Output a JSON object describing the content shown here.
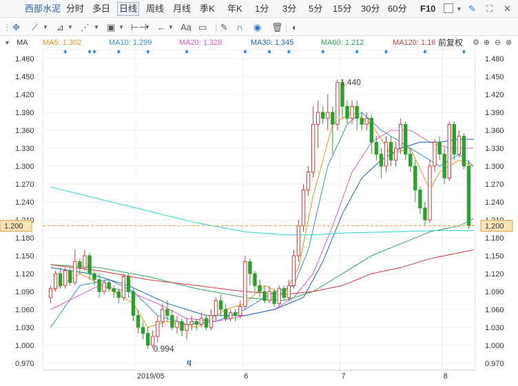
{
  "toolbar": {
    "symbol": "西部水泥",
    "periods": [
      "分时",
      "多日",
      "日线",
      "周线",
      "月线",
      "季K",
      "年K",
      "1分",
      "3分",
      "5分",
      "15分",
      "30分",
      "60分"
    ],
    "active_period": "日线",
    "f10": "F10"
  },
  "drawing_toolbar": {
    "aa_label": "Aa"
  },
  "ma_bar": {
    "title": "MA",
    "items": [
      {
        "label": "MA5: 1.302",
        "color": "#f0901a"
      },
      {
        "label": "MA10: 1.299",
        "color": "#2f8fe0"
      },
      {
        "label": "MA20: 1.328",
        "color": "#d85cd2"
      },
      {
        "label": "MA30: 1.345",
        "color": "#1565c0"
      },
      {
        "label": "MA60: 1.212",
        "color": "#2fa65a"
      },
      {
        "label": "MA120: 1.16",
        "color": "#d23b3b"
      }
    ],
    "adjust_label": "前复权"
  },
  "chart_data": {
    "type": "candlestick",
    "y_ticks": [
      "1.480",
      "1.450",
      "1.420",
      "1.390",
      "1.360",
      "1.330",
      "1.300",
      "1.270",
      "1.240",
      "1.210",
      "1.180",
      "1.150",
      "1.120",
      "1.090",
      "1.060",
      "1.030",
      "1.000",
      "0.970"
    ],
    "ylim": [
      0.97,
      1.48
    ],
    "x_labels": [
      "2019/05",
      "6",
      "7",
      "8"
    ],
    "current_price": "1.200",
    "max_label": "1.440",
    "min_label": "0.994",
    "marker_label": "q",
    "up_color": "#d23b3b",
    "down_color": "#2ca02c",
    "candles": [
      [
        1.08,
        1.095,
        1.07,
        1.1
      ],
      [
        1.095,
        1.12,
        1.09,
        1.125
      ],
      [
        1.12,
        1.1,
        1.095,
        1.13
      ],
      [
        1.1,
        1.125,
        1.095,
        1.13
      ],
      [
        1.125,
        1.105,
        1.1,
        1.13
      ],
      [
        1.105,
        1.14,
        1.1,
        1.16
      ],
      [
        1.14,
        1.13,
        1.12,
        1.145
      ],
      [
        1.13,
        1.15,
        1.125,
        1.16
      ],
      [
        1.15,
        1.12,
        1.11,
        1.155
      ],
      [
        1.12,
        1.11,
        1.1,
        1.125
      ],
      [
        1.11,
        1.09,
        1.08,
        1.12
      ],
      [
        1.09,
        1.105,
        1.085,
        1.11
      ],
      [
        1.105,
        1.095,
        1.09,
        1.11
      ],
      [
        1.095,
        1.09,
        1.08,
        1.1
      ],
      [
        1.09,
        1.08,
        1.07,
        1.095
      ],
      [
        1.08,
        1.115,
        1.075,
        1.12
      ],
      [
        1.115,
        1.09,
        1.08,
        1.12
      ],
      [
        1.09,
        1.05,
        1.04,
        1.095
      ],
      [
        1.05,
        1.03,
        1.02,
        1.06
      ],
      [
        1.03,
        1.02,
        1.01,
        1.04
      ],
      [
        1.02,
        1.0,
        0.994,
        1.03
      ],
      [
        1.0,
        1.015,
        0.995,
        1.025
      ],
      [
        1.015,
        1.04,
        1.005,
        1.05
      ],
      [
        1.04,
        1.06,
        1.03,
        1.07
      ],
      [
        1.06,
        1.05,
        1.04,
        1.075
      ],
      [
        1.05,
        1.03,
        1.025,
        1.06
      ],
      [
        1.03,
        1.04,
        1.02,
        1.05
      ],
      [
        1.04,
        1.025,
        1.015,
        1.045
      ],
      [
        1.025,
        1.035,
        1.01,
        1.045
      ],
      [
        1.035,
        1.04,
        1.025,
        1.05
      ],
      [
        1.04,
        1.035,
        1.025,
        1.045
      ],
      [
        1.035,
        1.045,
        1.03,
        1.055
      ],
      [
        1.045,
        1.03,
        1.025,
        1.05
      ],
      [
        1.03,
        1.05,
        1.025,
        1.06
      ],
      [
        1.05,
        1.075,
        1.04,
        1.08
      ],
      [
        1.075,
        1.06,
        1.05,
        1.085
      ],
      [
        1.06,
        1.045,
        1.04,
        1.07
      ],
      [
        1.045,
        1.055,
        1.04,
        1.06
      ],
      [
        1.055,
        1.05,
        1.04,
        1.06
      ],
      [
        1.05,
        1.065,
        1.045,
        1.075
      ],
      [
        1.065,
        1.14,
        1.06,
        1.15
      ],
      [
        1.14,
        1.12,
        1.1,
        1.145
      ],
      [
        1.12,
        1.1,
        1.09,
        1.125
      ],
      [
        1.1,
        1.09,
        1.08,
        1.11
      ],
      [
        1.09,
        1.075,
        1.07,
        1.1
      ],
      [
        1.075,
        1.09,
        1.07,
        1.1
      ],
      [
        1.09,
        1.07,
        1.065,
        1.095
      ],
      [
        1.07,
        1.095,
        1.065,
        1.1
      ],
      [
        1.095,
        1.08,
        1.075,
        1.1
      ],
      [
        1.08,
        1.1,
        1.075,
        1.11
      ],
      [
        1.1,
        1.15,
        1.095,
        1.16
      ],
      [
        1.15,
        1.2,
        1.14,
        1.21
      ],
      [
        1.2,
        1.26,
        1.19,
        1.27
      ],
      [
        1.26,
        1.29,
        1.25,
        1.3
      ],
      [
        1.29,
        1.37,
        1.28,
        1.4
      ],
      [
        1.37,
        1.39,
        1.33,
        1.41
      ],
      [
        1.39,
        1.38,
        1.37,
        1.4
      ],
      [
        1.38,
        1.39,
        1.36,
        1.42
      ],
      [
        1.39,
        1.37,
        1.32,
        1.4
      ],
      [
        1.37,
        1.44,
        1.36,
        1.445
      ],
      [
        1.44,
        1.4,
        1.38,
        1.445
      ],
      [
        1.4,
        1.38,
        1.37,
        1.41
      ],
      [
        1.38,
        1.4,
        1.37,
        1.41
      ],
      [
        1.4,
        1.38,
        1.36,
        1.41
      ],
      [
        1.38,
        1.37,
        1.36,
        1.39
      ],
      [
        1.37,
        1.38,
        1.36,
        1.39
      ],
      [
        1.38,
        1.34,
        1.32,
        1.385
      ],
      [
        1.34,
        1.32,
        1.31,
        1.35
      ],
      [
        1.32,
        1.3,
        1.28,
        1.33
      ],
      [
        1.3,
        1.34,
        1.29,
        1.35
      ],
      [
        1.34,
        1.31,
        1.3,
        1.35
      ],
      [
        1.31,
        1.33,
        1.3,
        1.34
      ],
      [
        1.33,
        1.37,
        1.32,
        1.38
      ],
      [
        1.37,
        1.32,
        1.31,
        1.375
      ],
      [
        1.32,
        1.3,
        1.29,
        1.33
      ],
      [
        1.3,
        1.26,
        1.24,
        1.31
      ],
      [
        1.26,
        1.23,
        1.22,
        1.265
      ],
      [
        1.23,
        1.21,
        1.2,
        1.24
      ],
      [
        1.21,
        1.3,
        1.205,
        1.31
      ],
      [
        1.3,
        1.34,
        1.29,
        1.345
      ],
      [
        1.34,
        1.32,
        1.31,
        1.35
      ],
      [
        1.32,
        1.28,
        1.27,
        1.33
      ],
      [
        1.28,
        1.37,
        1.275,
        1.375
      ],
      [
        1.37,
        1.32,
        1.31,
        1.375
      ],
      [
        1.32,
        1.35,
        1.315,
        1.36
      ],
      [
        1.35,
        1.3,
        1.295,
        1.355
      ],
      [
        1.3,
        1.2,
        1.195,
        1.31
      ]
    ],
    "ma_series": [
      {
        "name": "MA5",
        "color": "#f0901a",
        "points": [
          [
            0,
            1.09
          ],
          [
            6,
            1.12
          ],
          [
            12,
            1.095
          ],
          [
            17,
            1.07
          ],
          [
            20,
            1.03
          ],
          [
            24,
            1.04
          ],
          [
            30,
            1.03
          ],
          [
            36,
            1.06
          ],
          [
            40,
            1.07
          ],
          [
            44,
            1.1
          ],
          [
            48,
            1.085
          ],
          [
            51,
            1.13
          ],
          [
            54,
            1.25
          ],
          [
            58,
            1.37
          ],
          [
            62,
            1.39
          ],
          [
            66,
            1.37
          ],
          [
            70,
            1.32
          ],
          [
            74,
            1.33
          ],
          [
            78,
            1.26
          ],
          [
            80,
            1.29
          ],
          [
            84,
            1.31
          ],
          [
            87,
            1.3
          ]
        ]
      },
      {
        "name": "MA10",
        "color": "#2f8fe0",
        "points": [
          [
            0,
            1.03
          ],
          [
            6,
            1.1
          ],
          [
            12,
            1.11
          ],
          [
            17,
            1.09
          ],
          [
            22,
            1.05
          ],
          [
            28,
            1.035
          ],
          [
            34,
            1.04
          ],
          [
            40,
            1.06
          ],
          [
            45,
            1.085
          ],
          [
            50,
            1.1
          ],
          [
            53,
            1.16
          ],
          [
            57,
            1.3
          ],
          [
            61,
            1.37
          ],
          [
            64,
            1.39
          ],
          [
            68,
            1.36
          ],
          [
            72,
            1.34
          ],
          [
            76,
            1.32
          ],
          [
            80,
            1.3
          ],
          [
            84,
            1.32
          ],
          [
            87,
            1.3
          ]
        ]
      },
      {
        "name": "MA20",
        "color": "#d85cd2",
        "points": [
          [
            0,
            1.06
          ],
          [
            5,
            1.08
          ],
          [
            10,
            1.1
          ],
          [
            16,
            1.09
          ],
          [
            22,
            1.07
          ],
          [
            28,
            1.045
          ],
          [
            34,
            1.04
          ],
          [
            40,
            1.05
          ],
          [
            46,
            1.06
          ],
          [
            50,
            1.08
          ],
          [
            54,
            1.12
          ],
          [
            58,
            1.2
          ],
          [
            62,
            1.29
          ],
          [
            66,
            1.34
          ],
          [
            70,
            1.36
          ],
          [
            74,
            1.36
          ],
          [
            78,
            1.34
          ],
          [
            82,
            1.33
          ],
          [
            87,
            1.33
          ]
        ]
      },
      {
        "name": "MA30",
        "color": "#1565c0",
        "points": [
          [
            0,
            1.13
          ],
          [
            8,
            1.12
          ],
          [
            16,
            1.1
          ],
          [
            24,
            1.07
          ],
          [
            32,
            1.05
          ],
          [
            40,
            1.05
          ],
          [
            46,
            1.06
          ],
          [
            52,
            1.08
          ],
          [
            56,
            1.14
          ],
          [
            60,
            1.22
          ],
          [
            64,
            1.28
          ],
          [
            68,
            1.31
          ],
          [
            72,
            1.33
          ],
          [
            76,
            1.34
          ],
          [
            80,
            1.34
          ],
          [
            84,
            1.345
          ],
          [
            87,
            1.345
          ]
        ]
      },
      {
        "name": "MA60",
        "color": "#2fa65a",
        "points": [
          [
            0,
            1.135
          ],
          [
            10,
            1.13
          ],
          [
            20,
            1.115
          ],
          [
            30,
            1.095
          ],
          [
            40,
            1.08
          ],
          [
            48,
            1.075
          ],
          [
            54,
            1.09
          ],
          [
            60,
            1.12
          ],
          [
            66,
            1.15
          ],
          [
            72,
            1.17
          ],
          [
            78,
            1.19
          ],
          [
            84,
            1.2
          ],
          [
            87,
            1.212
          ]
        ]
      },
      {
        "name": "MA120",
        "color": "#d23b3b",
        "points": [
          [
            0,
            1.135
          ],
          [
            10,
            1.125
          ],
          [
            20,
            1.11
          ],
          [
            30,
            1.1
          ],
          [
            40,
            1.09
          ],
          [
            48,
            1.085
          ],
          [
            54,
            1.09
          ],
          [
            60,
            1.1
          ],
          [
            66,
            1.12
          ],
          [
            72,
            1.13
          ],
          [
            78,
            1.145
          ],
          [
            84,
            1.155
          ],
          [
            87,
            1.16
          ]
        ]
      },
      {
        "name": "MA250",
        "color": "#27d3d3",
        "points": [
          [
            0,
            1.265
          ],
          [
            10,
            1.245
          ],
          [
            20,
            1.225
          ],
          [
            30,
            1.205
          ],
          [
            40,
            1.19
          ],
          [
            48,
            1.185
          ],
          [
            54,
            1.185
          ],
          [
            60,
            1.188
          ],
          [
            70,
            1.19
          ],
          [
            80,
            1.192
          ],
          [
            87,
            1.192
          ]
        ]
      }
    ]
  }
}
